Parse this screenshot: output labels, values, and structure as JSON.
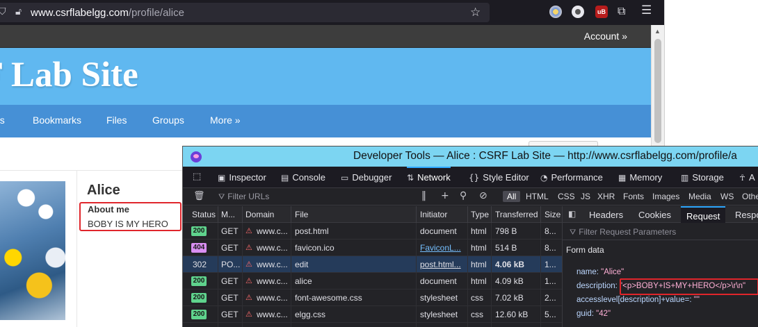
{
  "browser": {
    "url_host": "www.csrflabelgg.com",
    "url_path": "/profile/alice",
    "ublock_badge": "uB"
  },
  "site": {
    "account_link": "Account »",
    "title": "F Lab Site",
    "nav": [
      "gs",
      "Bookmarks",
      "Files",
      "Groups",
      "More »"
    ],
    "profile": {
      "name": "Alice",
      "about_label": "About me",
      "about_value": "BOBY IS MY HERO"
    }
  },
  "devtools": {
    "window_title": "Developer Tools — Alice : CSRF Lab Site — http://www.csrflabelgg.com/profile/a",
    "tabs": [
      {
        "label": "Inspector",
        "icon": "inspector-icon"
      },
      {
        "label": "Console",
        "icon": "console-icon"
      },
      {
        "label": "Debugger",
        "icon": "debugger-icon"
      },
      {
        "label": "Network",
        "icon": "network-icon"
      },
      {
        "label": "Style Editor",
        "icon": "style-editor-icon"
      },
      {
        "label": "Performance",
        "icon": "performance-icon"
      },
      {
        "label": "Memory",
        "icon": "memory-icon"
      },
      {
        "label": "Storage",
        "icon": "storage-icon"
      },
      {
        "label": "A",
        "icon": "accessibility-icon"
      }
    ],
    "selected_tab": "Network",
    "filter_placeholder": "Filter URLs",
    "type_filters": [
      "All",
      "HTML",
      "CSS",
      "JS",
      "XHR",
      "Fonts",
      "Images",
      "Media",
      "WS",
      "Othe"
    ],
    "selected_type_filter": "All",
    "columns": [
      "Status",
      "M...",
      "Domain",
      "File",
      "Initiator",
      "Type",
      "Transferred",
      "Size"
    ],
    "requests": [
      {
        "status": "200",
        "method": "GET",
        "domain": "www.c...",
        "file": "post.html",
        "initiator": "document",
        "type": "html",
        "transferred": "798 B",
        "size": "8..."
      },
      {
        "status": "404",
        "method": "GET",
        "domain": "www.c...",
        "file": "favicon.ico",
        "initiator": "FaviconL...",
        "type": "html",
        "transferred": "514 B",
        "size": "8..."
      },
      {
        "status": "302",
        "method": "PO...",
        "domain": "www.c...",
        "file": "edit",
        "initiator": "post.html...",
        "type": "html",
        "transferred": "4.06 kB",
        "size": "1..."
      },
      {
        "status": "200",
        "method": "GET",
        "domain": "www.c...",
        "file": "alice",
        "initiator": "document",
        "type": "html",
        "transferred": "4.09 kB",
        "size": "1..."
      },
      {
        "status": "200",
        "method": "GET",
        "domain": "www.c...",
        "file": "font-awesome.css",
        "initiator": "stylesheet",
        "type": "css",
        "transferred": "7.02 kB",
        "size": "2..."
      },
      {
        "status": "200",
        "method": "GET",
        "domain": "www.c...",
        "file": "elgg.css",
        "initiator": "stylesheet",
        "type": "css",
        "transferred": "12.60 kB",
        "size": "5..."
      }
    ],
    "status_colors": {
      "200": "#5fd38d",
      "404": "#d98ff2"
    },
    "details": {
      "tabs": [
        "Headers",
        "Cookies",
        "Request",
        "Respo"
      ],
      "selected_tab": "Request",
      "filter_placeholder": "Filter Request Parameters",
      "form_title": "Form data",
      "fields": [
        {
          "key": "name:",
          "value": "\"Alice\""
        },
        {
          "key": "description:",
          "value": "\"<p>BOBY+IS+MY+HERO</p>\\r\\n\""
        },
        {
          "key": "accesslevel[description]+value=:",
          "value": "\"\""
        },
        {
          "key": "guid:",
          "value": "\"42\""
        }
      ]
    }
  }
}
